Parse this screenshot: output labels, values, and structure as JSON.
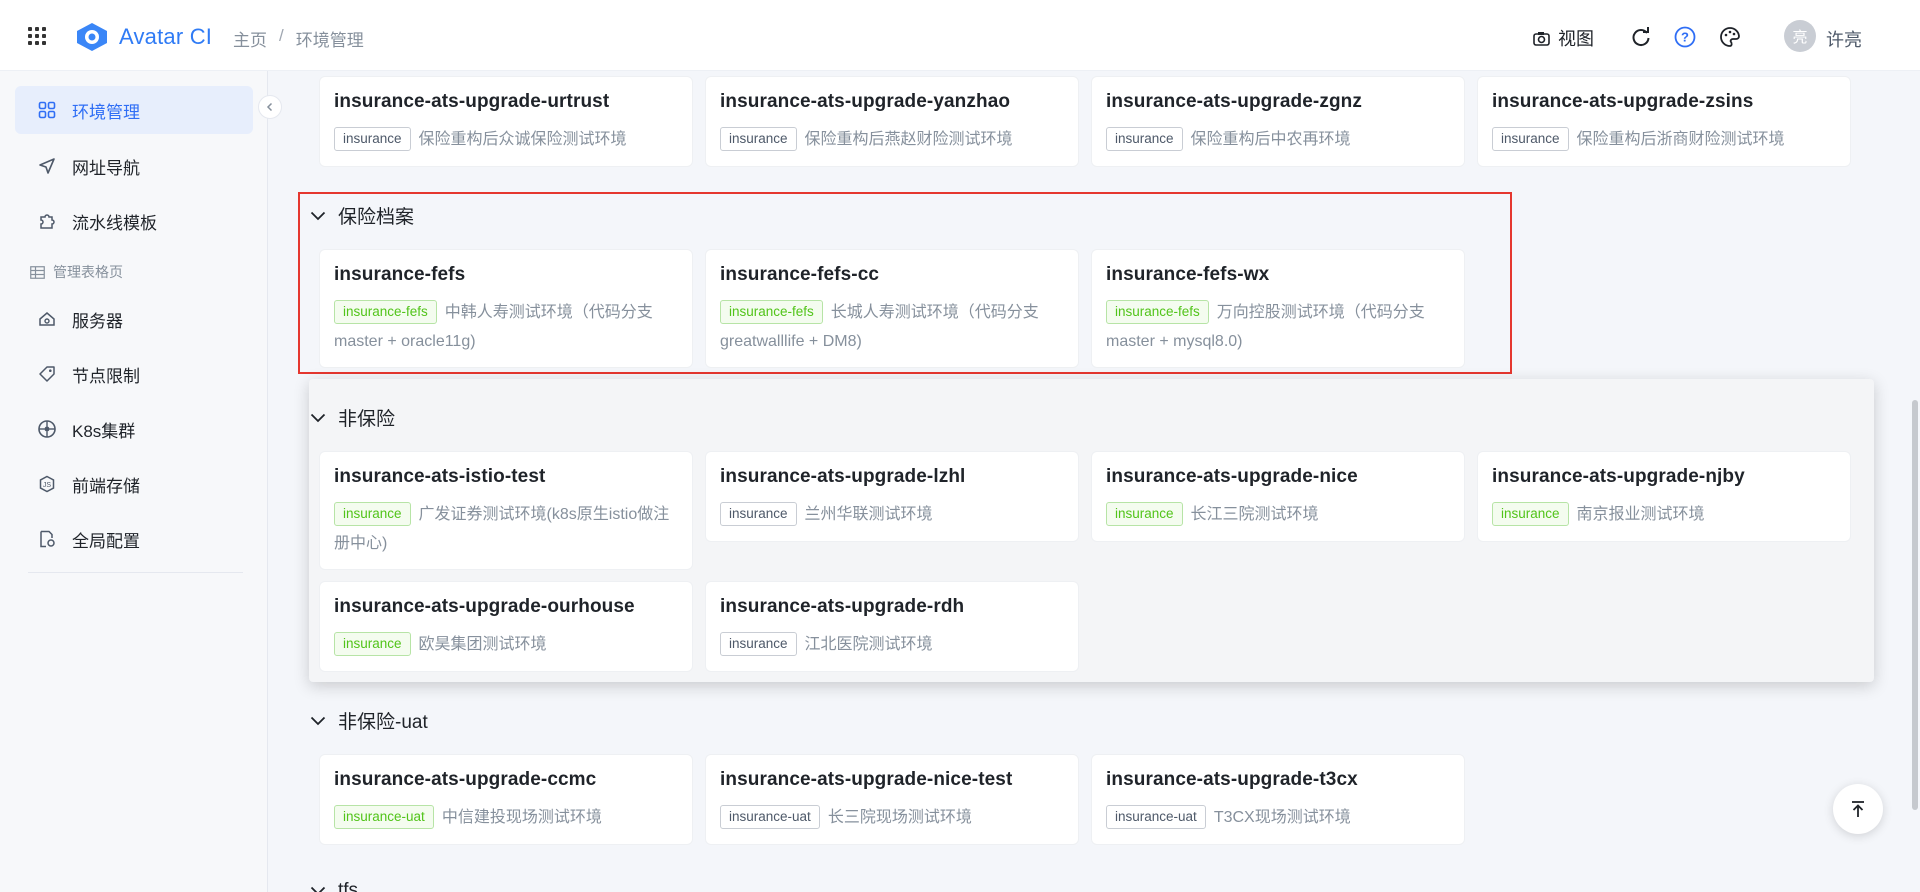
{
  "header": {
    "app_name": "Avatar CI",
    "breadcrumb": [
      "主页",
      "环境管理"
    ],
    "view_label": "视图",
    "user_initial": "亮",
    "user_name": "许亮"
  },
  "sidebar": {
    "items": [
      {
        "label": "环境管理",
        "icon": "grid-icon"
      },
      {
        "label": "网址导航",
        "icon": "send-icon"
      },
      {
        "label": "流水线模板",
        "icon": "puzzle-icon"
      },
      {
        "label": "服务器",
        "icon": "server-icon"
      },
      {
        "label": "节点限制",
        "icon": "tag-icon"
      },
      {
        "label": "K8s集群",
        "icon": "helm-icon"
      },
      {
        "label": "前端存储",
        "icon": "storage-icon"
      },
      {
        "label": "全局配置",
        "icon": "config-icon"
      }
    ],
    "group_label": "管理表格页"
  },
  "sections": {
    "top_row": [
      {
        "title": "insurance-ats-upgrade-urtrust",
        "tag": "insurance",
        "desc": "保险重构后众诚保险测试环境"
      },
      {
        "title": "insurance-ats-upgrade-yanzhao",
        "tag": "insurance",
        "desc": "保险重构后燕赵财险测试环境"
      },
      {
        "title": "insurance-ats-upgrade-zgnz",
        "tag": "insurance",
        "desc": "保险重构后中农再环境"
      },
      {
        "title": "insurance-ats-upgrade-zsins",
        "tag": "insurance",
        "desc": "保险重构后浙商财险测试环境"
      }
    ],
    "archive": {
      "title": "保险档案",
      "cards": [
        {
          "title": "insurance-fefs",
          "tag": "insurance-fefs",
          "desc": "中韩人寿测试环境（代码分支master + oracle11g)"
        },
        {
          "title": "insurance-fefs-cc",
          "tag": "insurance-fefs",
          "desc": "长城人寿测试环境（代码分支greatwalllife + DM8)"
        },
        {
          "title": "insurance-fefs-wx",
          "tag": "insurance-fefs",
          "desc": "万向控股测试环境（代码分支master + mysql8.0)"
        }
      ]
    },
    "non_insurance": {
      "title": "非保险",
      "cards": [
        {
          "title": "insurance-ats-istio-test",
          "tag": "insurance",
          "desc": "广发证券测试环境(k8s原生istio做注册中心)"
        },
        {
          "title": "insurance-ats-upgrade-lzhl",
          "tag": "insurance",
          "desc": "兰州华联测试环境"
        },
        {
          "title": "insurance-ats-upgrade-nice",
          "tag": "insurance",
          "desc": "长江三院测试环境"
        },
        {
          "title": "insurance-ats-upgrade-njby",
          "tag": "insurance",
          "desc": "南京报业测试环境"
        },
        {
          "title": "insurance-ats-upgrade-ourhouse",
          "tag": "insurance",
          "desc": "欧昊集团测试环境"
        },
        {
          "title": "insurance-ats-upgrade-rdh",
          "tag": "insurance",
          "desc": "江北医院测试环境"
        }
      ]
    },
    "non_insurance_uat": {
      "title": "非保险-uat",
      "cards": [
        {
          "title": "insurance-ats-upgrade-ccmc",
          "tag": "insurance-uat",
          "desc": "中信建投现场测试环境"
        },
        {
          "title": "insurance-ats-upgrade-nice-test",
          "tag": "insurance-uat",
          "desc": "长三院现场测试环境"
        },
        {
          "title": "insurance-ats-upgrade-t3cx",
          "tag": "insurance-uat",
          "desc": "T3CX现场测试环境"
        }
      ]
    },
    "tfs": {
      "title": "tfs"
    }
  },
  "colors": {
    "accent": "#2f6ef5",
    "highlight": "#e5372f",
    "tag_green": "#52c41a"
  }
}
